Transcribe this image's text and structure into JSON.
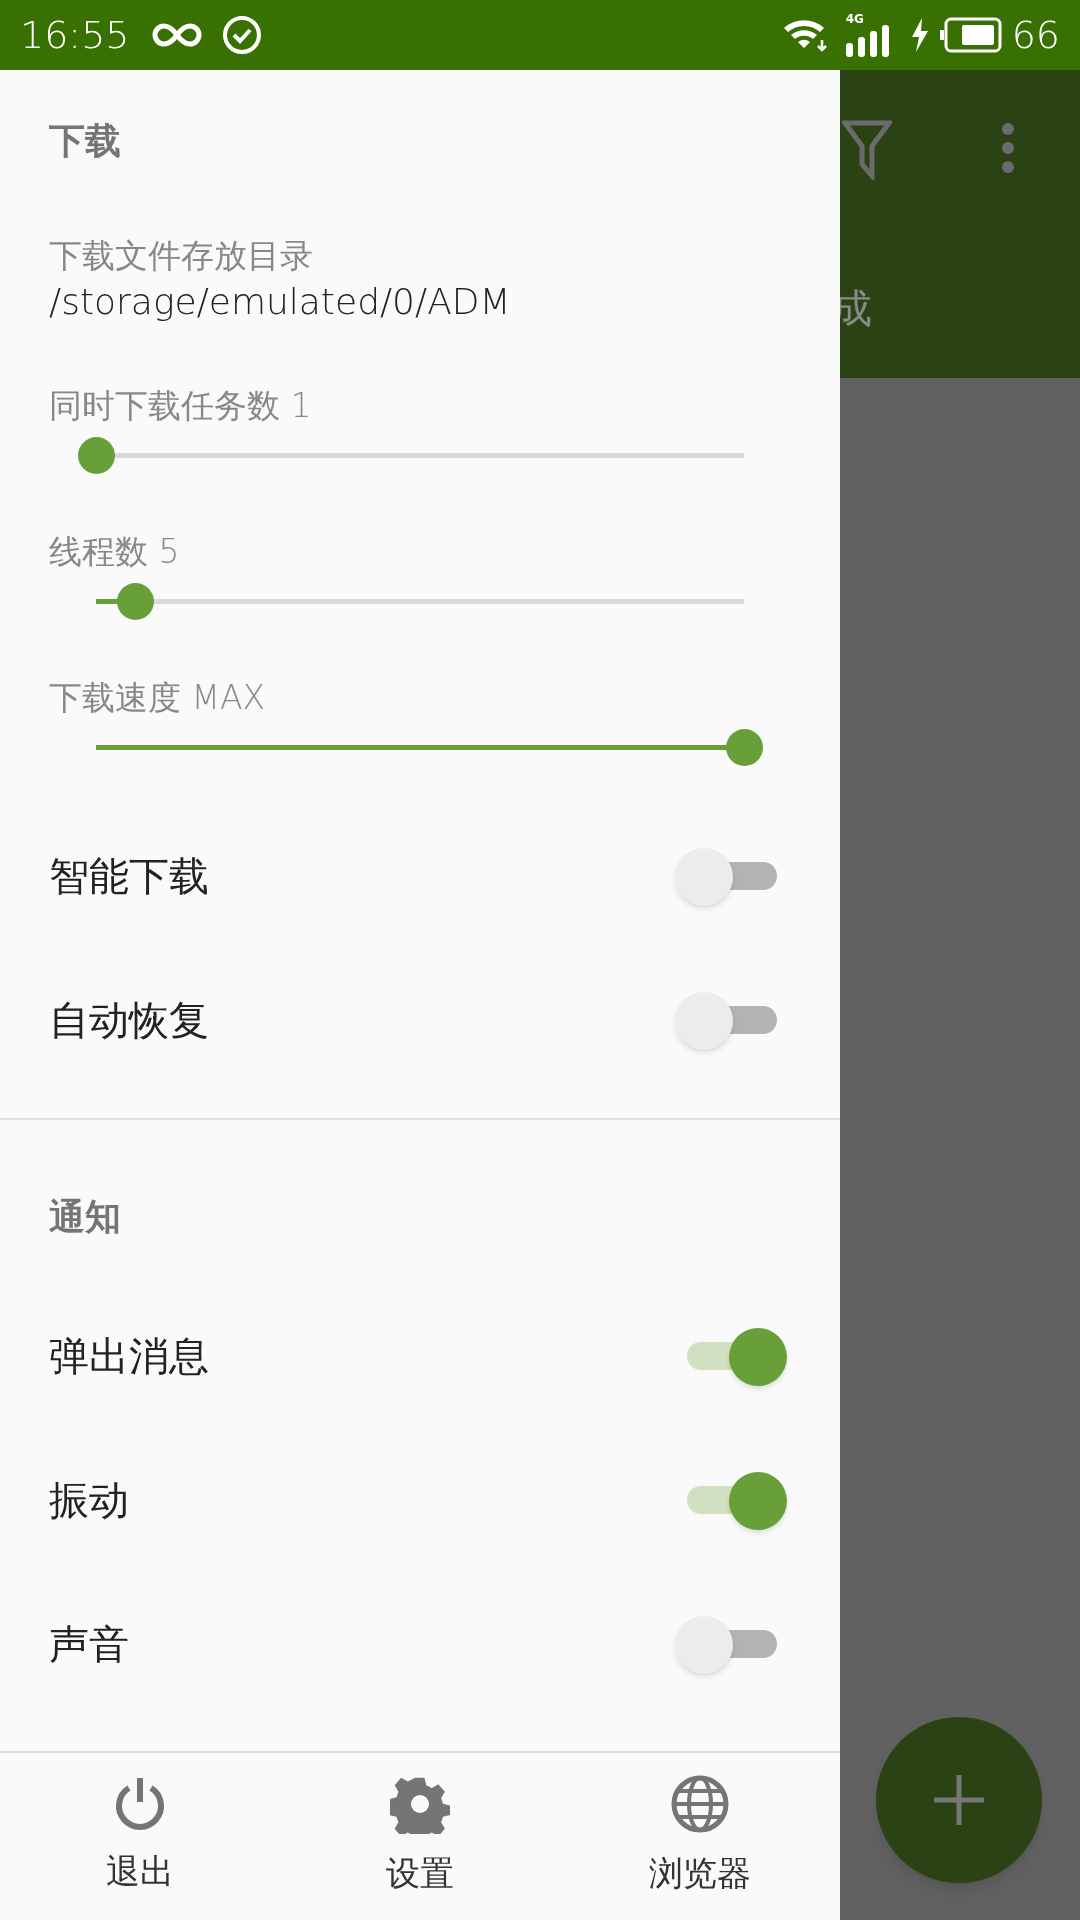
{
  "status_bar": {
    "time": "16:55",
    "network": "4G",
    "battery": "66"
  },
  "background": {
    "partial_text": "成"
  },
  "sections": [
    {
      "title": "下载",
      "items": [
        {
          "kind": "path",
          "label": "下载文件存放目录",
          "value": "/storage/emulated/0/ADM"
        },
        {
          "kind": "slider",
          "label": "同时下载任务数 1",
          "level": 0
        },
        {
          "kind": "slider",
          "label": "线程数 5",
          "level": 0.06
        },
        {
          "kind": "slider",
          "label": "下载速度 MAX",
          "level": 1
        },
        {
          "kind": "switch",
          "label": "智能下载",
          "on": false
        },
        {
          "kind": "switch",
          "label": "自动恢复",
          "on": false
        }
      ]
    },
    {
      "title": "通知",
      "items": [
        {
          "kind": "switch",
          "label": "弹出消息",
          "on": true
        },
        {
          "kind": "switch",
          "label": "振动",
          "on": true
        },
        {
          "kind": "switch",
          "label": "声音",
          "on": false
        }
      ]
    }
  ],
  "bottom_bar": [
    {
      "kind": "power",
      "label": "退出"
    },
    {
      "kind": "gear",
      "label": "设置"
    },
    {
      "kind": "globe",
      "label": "浏览器"
    }
  ]
}
